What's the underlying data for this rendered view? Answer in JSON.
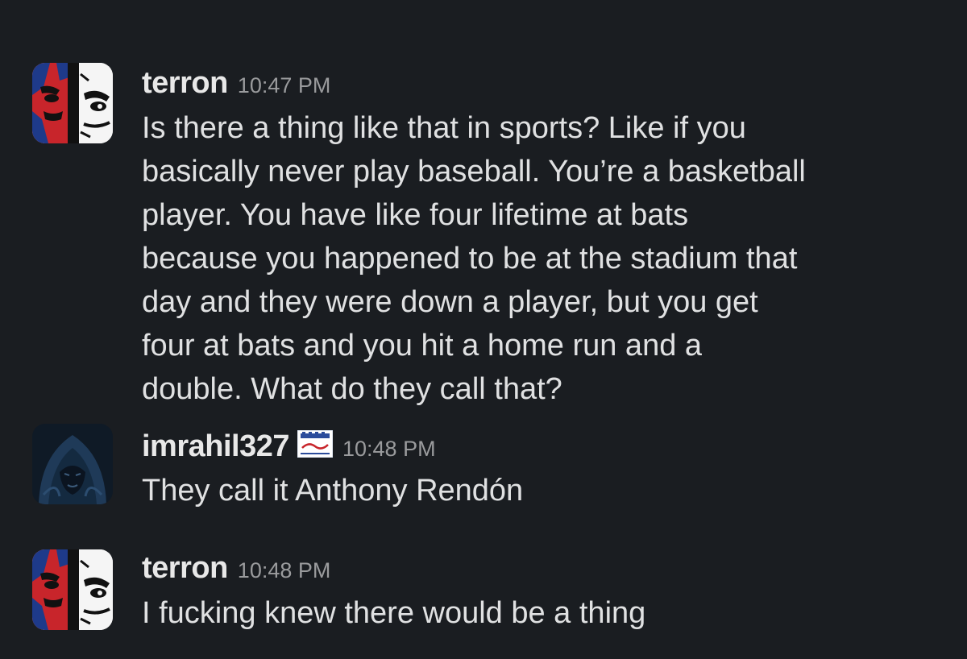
{
  "messages": [
    {
      "username": "terron",
      "timestamp": "10:47 PM",
      "avatar_icon": "red-blue-face-art-avatar",
      "text": "Is there a thing like that in sports? Like if you\nbasically never play baseball. You’re a basketball\nplayer. You have like four lifetime at bats\nbecause you happened to be at the stadium that\nday and they were down a player, but you get\nfour at bats and you hit a home run and a\ndouble. What do they call that?"
    },
    {
      "username": "imrahil327",
      "timestamp": "10:48 PM",
      "avatar_icon": "hooded-figure-avatar",
      "badge_icon": "custom-emoji-badge",
      "text": "They call it Anthony Rendón"
    },
    {
      "username": "terron",
      "timestamp": "10:48 PM",
      "avatar_icon": "red-blue-face-art-avatar",
      "text": "I fucking knew there would be a thing"
    }
  ],
  "colors": {
    "background": "#1a1d21",
    "username": "#e8e8e8",
    "timestamp": "#9a9b9d",
    "text": "#e0e1e2"
  }
}
